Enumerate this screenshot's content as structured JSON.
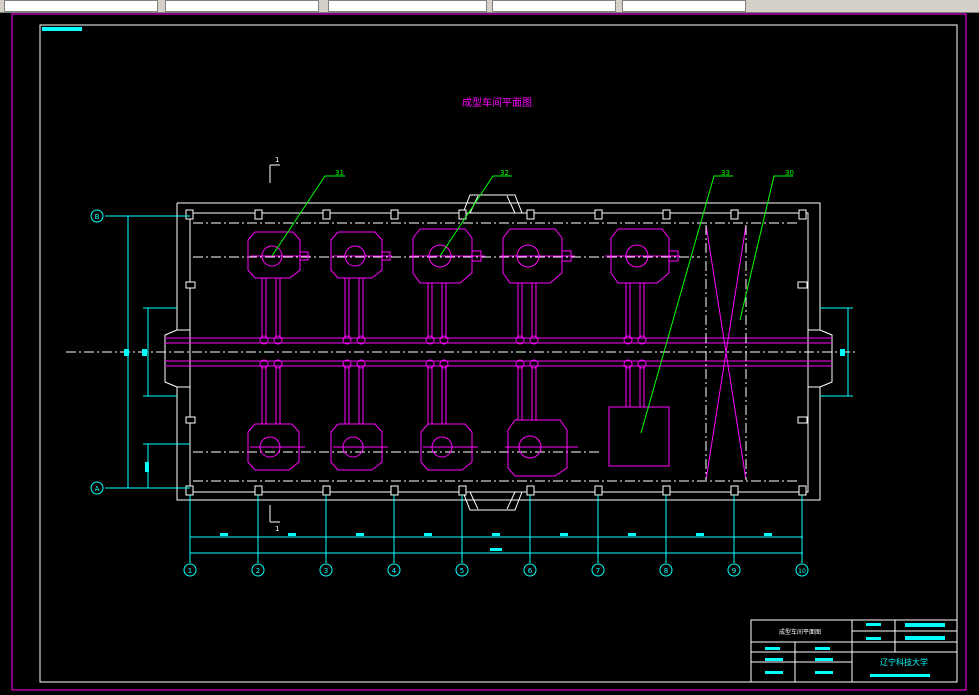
{
  "app": {
    "toolbar": {
      "fields": [
        "",
        "",
        "",
        "",
        ""
      ]
    }
  },
  "drawing": {
    "title": "成型车间平面图",
    "colors": {
      "frame": "#ff00ff",
      "walls": "#ffffff",
      "machines": "#ff00ff",
      "dimensions": "#00ffff",
      "leaders": "#00ff00",
      "axes": "#ffffff"
    },
    "callouts": [
      "31",
      "32",
      "33",
      "30"
    ],
    "section_marks": [
      "1",
      "1"
    ],
    "grid_rows": [
      "B",
      "A"
    ],
    "grid_columns": [
      "1",
      "2",
      "3",
      "4",
      "5",
      "6",
      "7",
      "8",
      "9",
      "10"
    ],
    "title_block": {
      "drawing_name": "成型车间平面图",
      "school": "辽宁科技大学"
    }
  }
}
